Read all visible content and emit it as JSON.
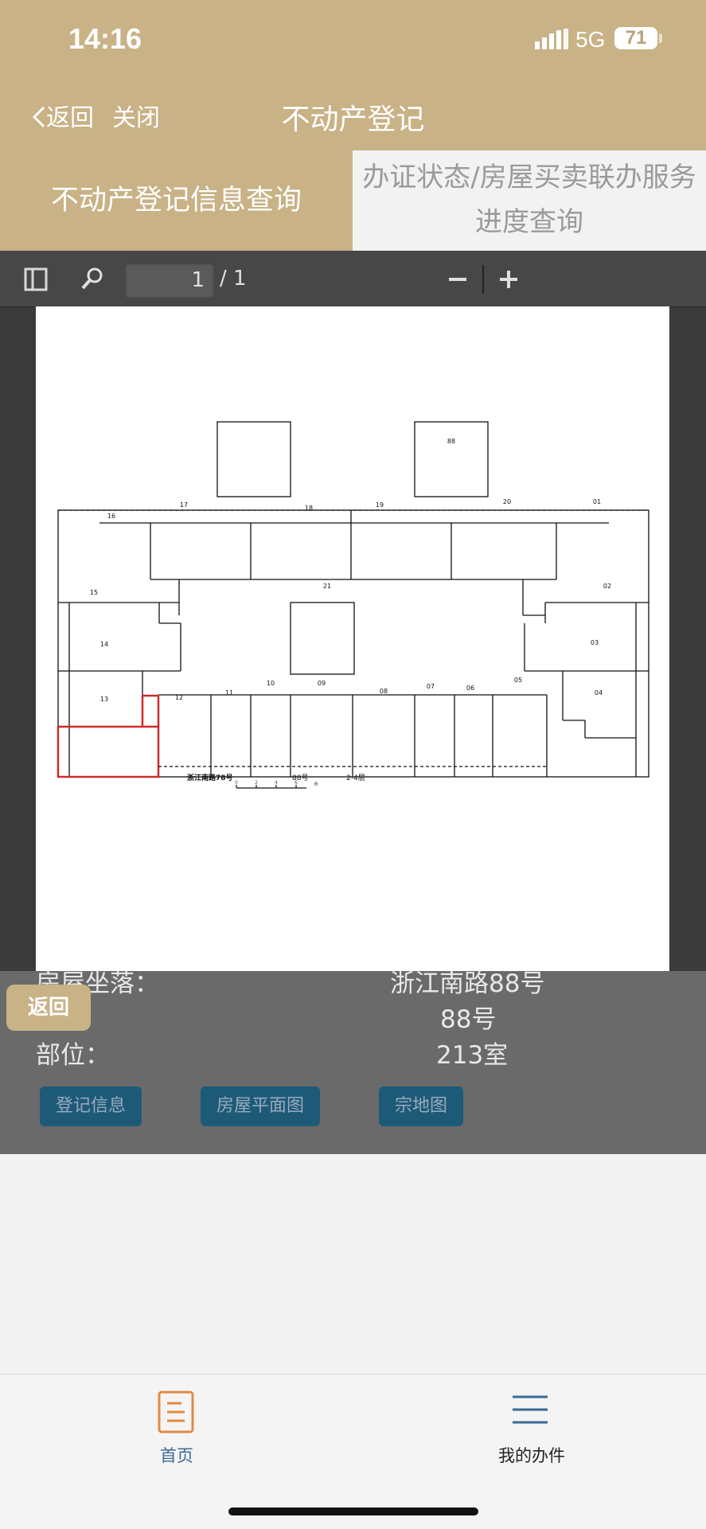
{
  "status_bar": {
    "time": "14:16",
    "network": "5G",
    "battery": "71"
  },
  "nav": {
    "back": "返回",
    "close": "关闭",
    "title": "不动产登记"
  },
  "tabs": {
    "left": "不动产登记信息查询",
    "right_line1": "办证状态/房屋买卖联办服务",
    "right_line2": "进度查询"
  },
  "pdf_viewer": {
    "page_current": "1",
    "page_total": "/ 1",
    "plan": {
      "rooms": [
        "01",
        "02",
        "03",
        "04",
        "05",
        "06",
        "07",
        "08",
        "09",
        "10",
        "11",
        "12",
        "13",
        "14",
        "15",
        "16",
        "17",
        "18",
        "19",
        "20",
        "21",
        "88"
      ],
      "highlight_room": "13",
      "footer_address": "浙江南路78号",
      "footer_building": "88号",
      "footer_floor": "2-4层",
      "scale_ticks": [
        "0",
        "2",
        "4",
        "6"
      ],
      "scale_unit": "米"
    }
  },
  "info": {
    "location_label": "房屋坐落：",
    "location_value": "浙江南路88号",
    "building_value": "88号",
    "part_label": "部位：",
    "part_value": "213室"
  },
  "info_buttons": {
    "registration": "登记信息",
    "floor_plan": "房屋平面图",
    "parcel_map": "宗地图"
  },
  "float_return": "返回",
  "bottom_nav": {
    "home": "首页",
    "my_tasks": "我的办件"
  },
  "colors": {
    "brand": "#c8b286",
    "button": "#1d5a78",
    "highlight": "#d12a2a",
    "active_tab_icon": "#e08a45"
  }
}
